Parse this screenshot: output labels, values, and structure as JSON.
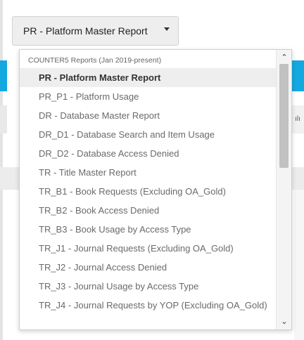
{
  "select": {
    "value": "PR - Platform Master Report",
    "caret_icon": "chevron-down-icon"
  },
  "dropdown": {
    "group_label": "COUNTER5 Reports (Jan 2019-present)",
    "options": [
      "PR - Platform Master Report",
      "PR_P1 - Platform Usage",
      "DR - Database Master Report",
      "DR_D1 - Database Search and Item Usage",
      "DR_D2 - Database Access Denied",
      "TR - Title Master Report",
      "TR_B1 - Book Requests (Excluding OA_Gold)",
      "TR_B2 - Book Access Denied",
      "TR_B3 - Book Usage by Access Type",
      "TR_J1 - Journal Requests (Excluding OA_Gold)",
      "TR_J2 - Journal Access Denied",
      "TR_J3 - Journal Usage by Access Type",
      "TR_J4 - Journal Requests by YOP (Excluding OA_Gold)"
    ],
    "selected_index": 0,
    "scroll_up_glyph": "⌃",
    "scroll_down_glyph": "⌄"
  },
  "background": {
    "right_fragment": "ılı"
  },
  "colors": {
    "accent_blue": "#12a8e0",
    "selected_bg": "#eeeeee"
  }
}
